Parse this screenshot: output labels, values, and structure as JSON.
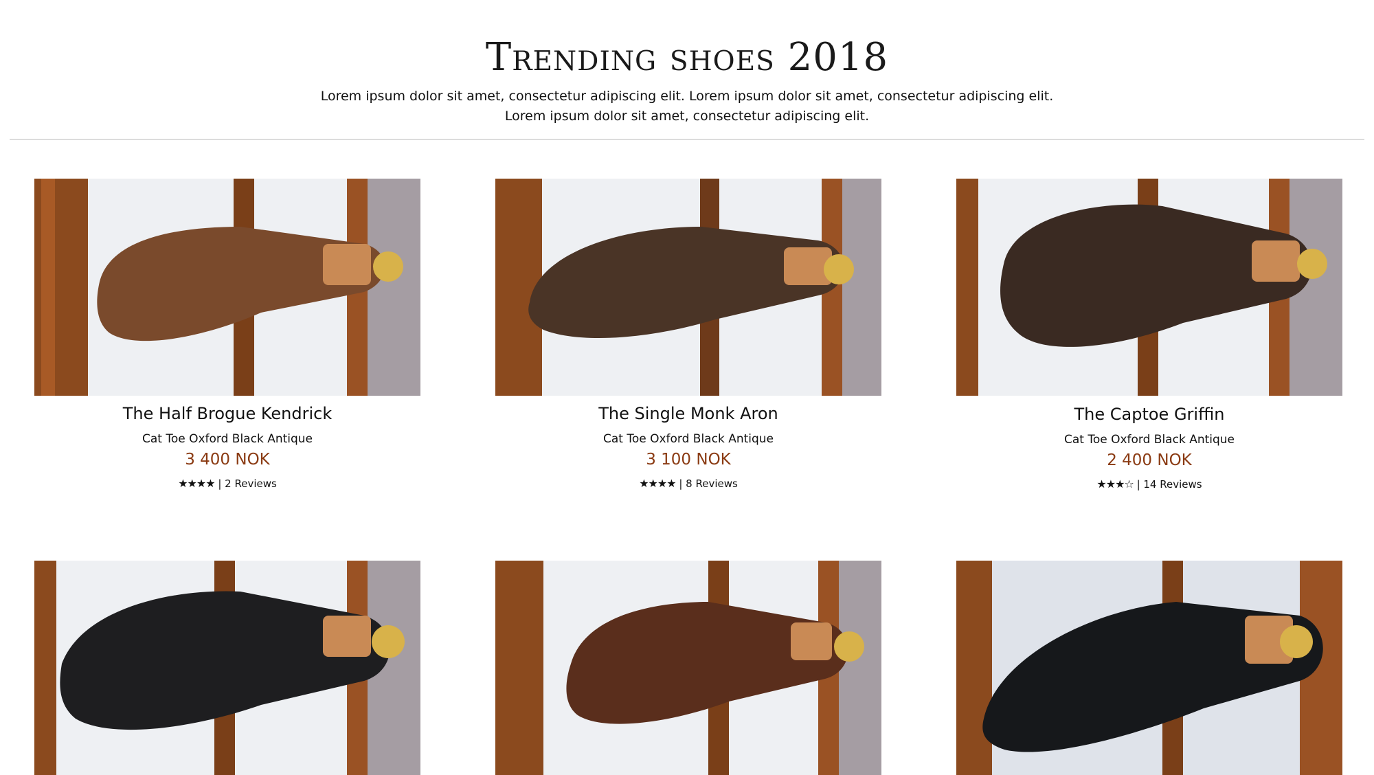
{
  "header": {
    "title": "Trending shoes 2018",
    "subtitle_line1": "Lorem ipsum dolor sit amet, consectetur adipiscing elit. Lorem ipsum dolor sit amet, consectetur adipiscing elit.",
    "subtitle_line2": "Lorem ipsum dolor sit amet, consectetur adipiscing elit."
  },
  "products": [
    {
      "name": "The Half Brogue Kendrick",
      "subtitle": "Cat Toe Oxford Black Antique",
      "price": "3 400 NOK",
      "stars": "★★★★",
      "rating": 4,
      "reviews": "| 2 Reviews",
      "shoe_color": "#7a4a2c"
    },
    {
      "name": "The Single Monk Aron",
      "subtitle": "Cat Toe Oxford Black Antique",
      "price": "3 100 NOK",
      "stars": "★★★★",
      "rating": 4,
      "reviews": "| 8 Reviews",
      "shoe_color": "#4a3426"
    },
    {
      "name": "The Captoe Griffin",
      "subtitle": "Cat Toe Oxford Black Antique",
      "price": "2 400 NOK",
      "stars": "★★★☆",
      "rating": 3,
      "reviews": "| 14 Reviews",
      "shoe_color": "#3a2a22"
    },
    {
      "name": "",
      "subtitle": "",
      "price": "",
      "stars": "",
      "rating": null,
      "reviews": "",
      "shoe_color": "#1e1e20"
    },
    {
      "name": "",
      "subtitle": "",
      "price": "",
      "stars": "",
      "rating": null,
      "reviews": "",
      "shoe_color": "#5a2e1c"
    },
    {
      "name": "",
      "subtitle": "",
      "price": "",
      "stars": "",
      "rating": null,
      "reviews": "",
      "shoe_color": "#16181b"
    }
  ],
  "colors": {
    "price": "#8a3a12",
    "divider": "#dcdcdc",
    "wood": "#8b4a1e",
    "backdrop": "#f1f1f3"
  }
}
